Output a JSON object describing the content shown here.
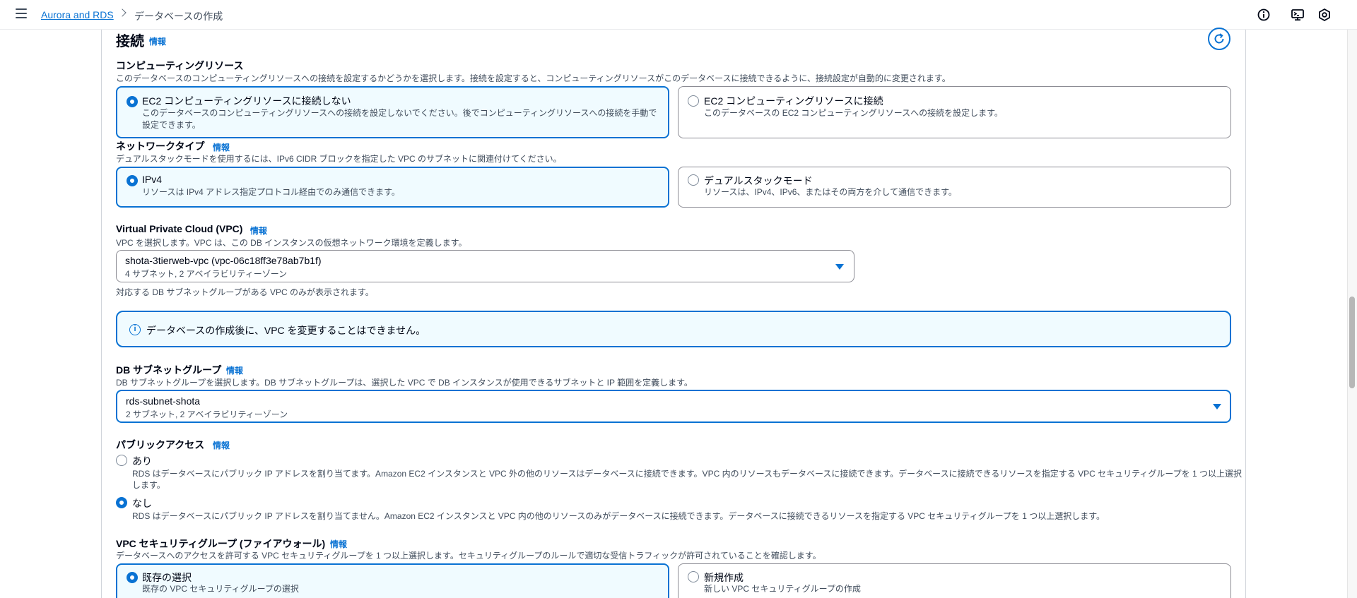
{
  "header": {
    "breadcrumb_link": "Aurora and RDS",
    "breadcrumb_current": "データベースの作成"
  },
  "section": {
    "title": "接続",
    "info": "情報"
  },
  "compute": {
    "label": "コンピューティングリソース",
    "description": "このデータベースのコンピューティングリソースへの接続を設定するかどうかを選択します。接続を設定すると、コンピューティングリソースがこのデータベースに接続できるように、接続設定が自動的に変更されます。",
    "options": [
      {
        "title": "EC2 コンピューティングリソースに接続しない",
        "desc1": "このデータベースのコンピューティングリソースへの接続を設定しないでください。後でコンピューティングリソースへの接続を手動で",
        "desc2": "設定できます。",
        "selected": true
      },
      {
        "title": "EC2 コンピューティングリソースに接続",
        "desc1": "このデータベースの EC2 コンピューティングリソースへの接続を設定します。",
        "selected": false
      }
    ]
  },
  "network": {
    "label": "ネットワークタイプ",
    "info": "情報",
    "description": "デュアルスタックモードを使用するには、IPv6 CIDR ブロックを指定した VPC のサブネットに関連付けてください。",
    "options": [
      {
        "title": "IPv4",
        "desc1": "リソースは IPv4 アドレス指定プロトコル経由でのみ通信できます。",
        "selected": true
      },
      {
        "title": "デュアルスタックモード",
        "desc1": "リソースは、IPv4、IPv6、またはその両方を介して通信できます。",
        "selected": false
      }
    ]
  },
  "vpc": {
    "label": "Virtual Private Cloud (VPC)",
    "info": "情報",
    "description": "VPC を選択します。VPC は、この DB インスタンスの仮想ネットワーク環境を定義します。",
    "selected": "shota-3tierweb-vpc (vpc-06c18ff3e78ab7b1f)",
    "selected_sub": "4 サブネット, 2 アベイラビリティーゾーン",
    "hint": "対応する DB サブネットグループがある VPC のみが表示されます。"
  },
  "alert": {
    "text": "データベースの作成後に、VPC を変更することはできません。"
  },
  "subnet": {
    "label": "DB サブネットグループ",
    "info": "情報",
    "description": "DB サブネットグループを選択します。DB サブネットグループは、選択した VPC で DB インスタンスが使用できるサブネットと IP 範囲を定義します。",
    "selected": "rds-subnet-shota",
    "selected_sub": "2 サブネット, 2 アベイラビリティーゾーン"
  },
  "public": {
    "label": "パブリックアクセス",
    "info": "情報",
    "options": [
      {
        "title": "あり",
        "desc1": "RDS はデータベースにパブリック IP アドレスを割り当てます。Amazon EC2 インスタンスと VPC 外の他のリソースはデータベースに接続できます。VPC 内のリソースもデータベースに接続できます。データベースに接続できるリソースを指定する VPC セキュリティグループを 1 つ以上選択",
        "desc2": "します。",
        "selected": false
      },
      {
        "title": "なし",
        "desc1": "RDS はデータベースにパブリック IP アドレスを割り当てません。Amazon EC2 インスタンスと VPC 内の他のリソースのみがデータベースに接続できます。データベースに接続できるリソースを指定する VPC セキュリティグループを 1 つ以上選択します。",
        "selected": true
      }
    ]
  },
  "sg": {
    "label": "VPC セキュリティグループ (ファイアウォール)",
    "info": "情報",
    "description": "データベースへのアクセスを許可する VPC セキュリティグループを 1 つ以上選択します。セキュリティグループのルールで適切な受信トラフィックが許可されていることを確認します。",
    "options": [
      {
        "title": "既存の選択",
        "desc1": "既存の VPC セキュリティグループの選択",
        "selected": true
      },
      {
        "title": "新規作成",
        "desc1": "新しい VPC セキュリティグループの作成",
        "selected": false
      }
    ]
  },
  "icons": {
    "menu": "menu-icon",
    "info_top": "info-circle-icon",
    "cloudshell": "cloudshell-icon",
    "settings": "settings-hex-icon",
    "refresh": "refresh-icon",
    "alert": "info-icon",
    "dropdown": "caret-down-icon"
  },
  "colors": {
    "accent": "#0972d3",
    "selected_bg": "#f0fbff",
    "text": "#000716",
    "muted": "#414d5c"
  }
}
